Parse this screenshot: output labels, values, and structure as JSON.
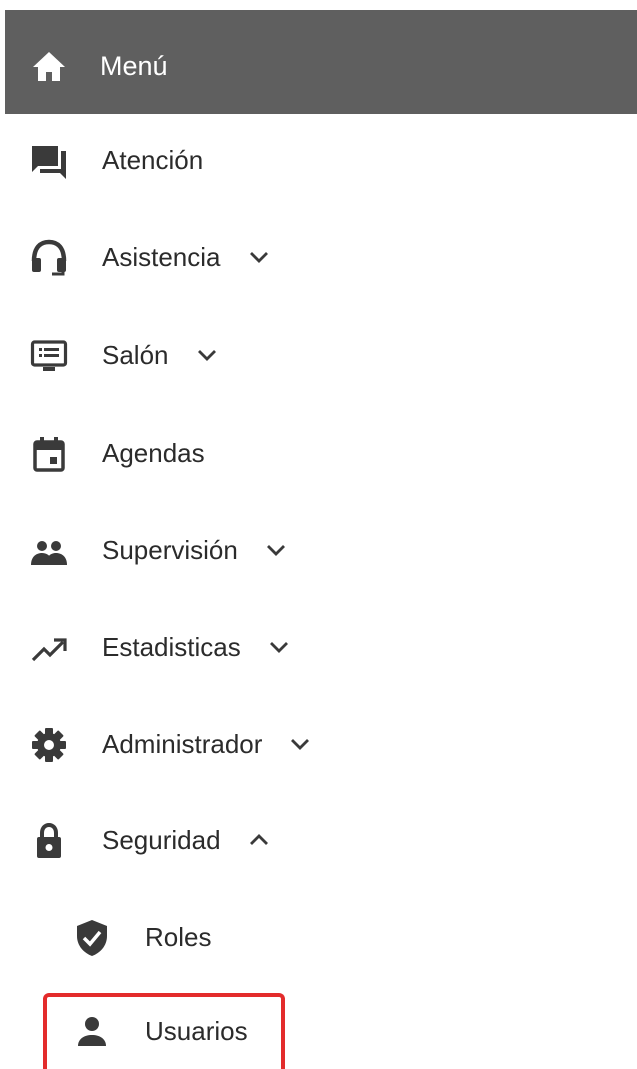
{
  "header": {
    "title": "Menú",
    "icon": "home-icon"
  },
  "menu": {
    "items": [
      {
        "label": "Atención",
        "icon": "chat-icon",
        "expandable": false
      },
      {
        "label": "Asistencia",
        "icon": "headset-icon",
        "expandable": true,
        "expanded": false
      },
      {
        "label": "Salón",
        "icon": "monitor-icon",
        "expandable": true,
        "expanded": false
      },
      {
        "label": "Agendas",
        "icon": "calendar-icon",
        "expandable": false
      },
      {
        "label": "Supervisión",
        "icon": "group-icon",
        "expandable": true,
        "expanded": false
      },
      {
        "label": "Estadisticas",
        "icon": "trending-up-icon",
        "expandable": true,
        "expanded": false
      },
      {
        "label": "Administrador",
        "icon": "gear-icon",
        "expandable": true,
        "expanded": false
      },
      {
        "label": "Seguridad",
        "icon": "lock-icon",
        "expandable": true,
        "expanded": true
      }
    ],
    "subitems": [
      {
        "label": "Roles",
        "icon": "shield-check-icon"
      },
      {
        "label": "Usuarios",
        "icon": "person-icon",
        "highlighted": true
      }
    ]
  },
  "colors": {
    "header_bg": "#5f5f5f",
    "icon": "#3a3a3a",
    "text": "#2b2b2b",
    "highlight": "#e32b2b"
  }
}
